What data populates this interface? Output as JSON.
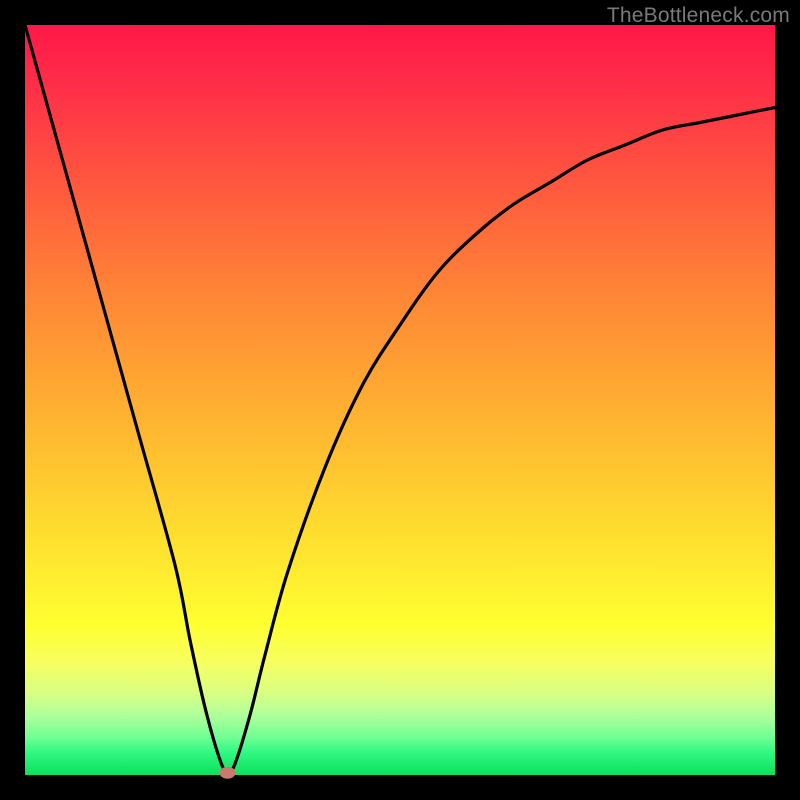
{
  "watermark": "TheBottleneck.com",
  "chart_data": {
    "type": "line",
    "title": "",
    "xlabel": "",
    "ylabel": "",
    "xlim": [
      0,
      100
    ],
    "ylim": [
      0,
      100
    ],
    "grid": false,
    "legend": false,
    "background_gradient": {
      "top": "#ff1848",
      "middle": "#ffde2f",
      "bottom": "#0ee25a"
    },
    "series": [
      {
        "name": "bottleneck-curve",
        "color": "#000000",
        "x": [
          0,
          5,
          10,
          15,
          20,
          22,
          24,
          26,
          27,
          28,
          30,
          32,
          35,
          40,
          45,
          50,
          55,
          60,
          65,
          70,
          75,
          80,
          85,
          90,
          95,
          100
        ],
        "values": [
          100,
          82,
          64,
          46,
          28,
          18,
          9,
          2,
          0.4,
          1.5,
          8,
          16,
          27,
          41,
          52,
          60,
          67,
          72,
          76,
          79,
          82,
          84,
          86,
          87,
          88,
          89
        ]
      }
    ],
    "marker": {
      "name": "optimum-point",
      "x": 27,
      "y": 0.3,
      "color": "#c97a6a"
    }
  }
}
